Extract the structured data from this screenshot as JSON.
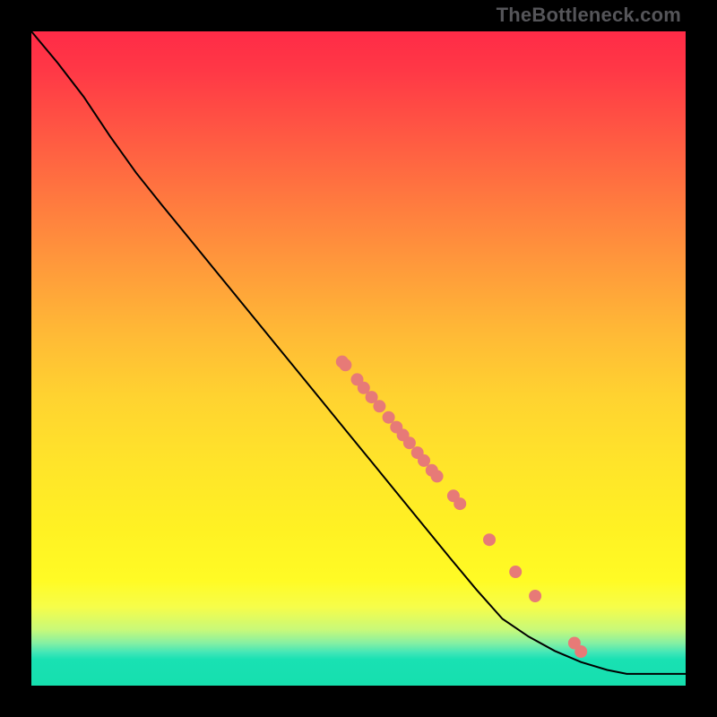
{
  "watermark": "TheBottleneck.com",
  "chart_data": {
    "type": "line",
    "title": "",
    "xlabel": "",
    "ylabel": "",
    "xlim": [
      0,
      100
    ],
    "ylim": [
      0,
      100
    ],
    "grid": false,
    "legend": false,
    "series": [
      {
        "name": "curve",
        "x": [
          0,
          4,
          8,
          12,
          16,
          20,
          24,
          28,
          32,
          36,
          40,
          44,
          48,
          52,
          56,
          60,
          64,
          68,
          72,
          76,
          80,
          84,
          88,
          91,
          100
        ],
        "y": [
          100,
          95.2,
          90.0,
          84.0,
          78.4,
          73.4,
          68.5,
          63.6,
          58.7,
          53.8,
          48.9,
          44.0,
          39.1,
          34.2,
          29.3,
          24.4,
          19.5,
          14.7,
          10.2,
          7.5,
          5.3,
          3.6,
          2.4,
          1.8,
          1.8
        ]
      }
    ],
    "points": {
      "name": "markers",
      "x": [
        47.5,
        48.0,
        49.8,
        50.8,
        52.0,
        53.2,
        54.6,
        55.8,
        56.8,
        57.8,
        59.0,
        60.0,
        61.2,
        62.0,
        64.5,
        65.5,
        70.0,
        74.0,
        77.0,
        83.0,
        84.0
      ],
      "y": [
        49.5,
        49.0,
        46.8,
        45.5,
        44.1,
        42.7,
        41.0,
        39.5,
        38.3,
        37.1,
        35.6,
        34.4,
        32.9,
        32.0,
        29.0,
        27.8,
        22.3,
        17.4,
        13.7,
        6.5,
        5.2
      ]
    }
  }
}
